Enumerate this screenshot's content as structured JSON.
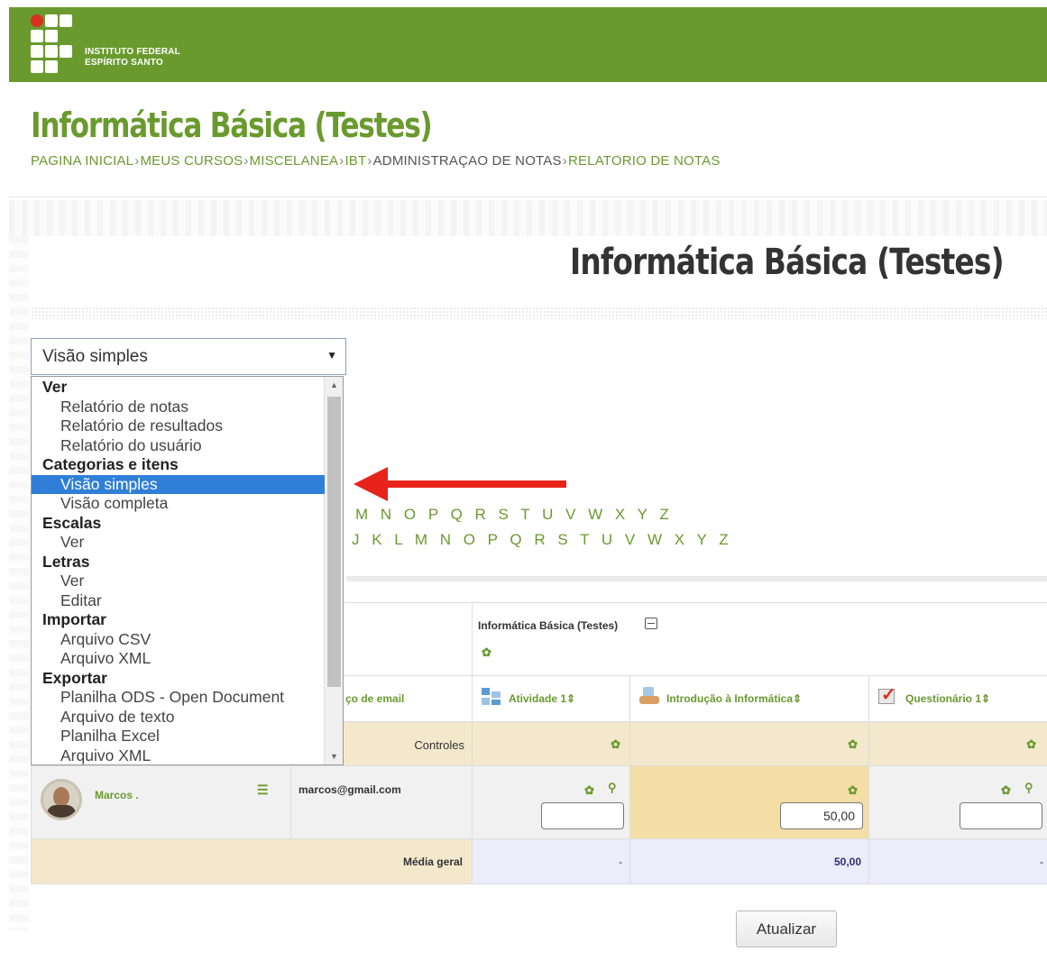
{
  "header": {
    "logo_line1": "INSTITUTO FEDERAL",
    "logo_line2": "ESPÍRITO SANTO",
    "brand_color": "#6a9a2e"
  },
  "course_title": "Informática Básica (Testes)",
  "breadcrumb": [
    "PAGINA INICIAL",
    "MEUS CURSOS",
    "MISCELANEA",
    "IBT",
    "ADMINISTRAÇAO DE NOTAS",
    "RELATORIO DE NOTAS"
  ],
  "page_heading": "Informática Básica (Testes)",
  "view_select": {
    "value": "Visão simples",
    "options": [
      {
        "type": "group",
        "label": "Ver"
      },
      {
        "type": "item",
        "label": "Relatório de notas"
      },
      {
        "type": "item",
        "label": "Relatório de resultados"
      },
      {
        "type": "item",
        "label": "Relatório do usuário"
      },
      {
        "type": "group",
        "label": "Categorias e itens"
      },
      {
        "type": "item",
        "label": "Visão simples",
        "selected": true
      },
      {
        "type": "item",
        "label": "Visão completa"
      },
      {
        "type": "group",
        "label": "Escalas"
      },
      {
        "type": "item",
        "label": "Ver"
      },
      {
        "type": "group",
        "label": "Letras"
      },
      {
        "type": "item",
        "label": "Ver"
      },
      {
        "type": "item",
        "label": "Editar"
      },
      {
        "type": "group",
        "label": "Importar"
      },
      {
        "type": "item",
        "label": "Arquivo CSV"
      },
      {
        "type": "item",
        "label": "Arquivo XML"
      },
      {
        "type": "group",
        "label": "Exportar"
      },
      {
        "type": "item",
        "label": "Planilha ODS - Open Document"
      },
      {
        "type": "item",
        "label": "Arquivo de texto"
      },
      {
        "type": "item",
        "label": "Planilha Excel"
      },
      {
        "type": "item",
        "label": "Arquivo XML"
      }
    ]
  },
  "letters_row1": "M N O P Q R S T U V W X Y Z",
  "letters_row2": "J K L M N O P Q R S T U V W X Y Z",
  "table": {
    "category_name": "Informática Básica (Testes)",
    "email_header": "ço de email",
    "columns": [
      "Atividade 1",
      "Introdução à Informática",
      "Questionário 1"
    ],
    "sort_icon": "⇕",
    "controls_label": "Controles",
    "student": {
      "name": "Marcos .",
      "email": "marcos@gmail.com"
    },
    "grades": [
      "",
      "50,00",
      ""
    ],
    "average_label": "Média geral",
    "averages": [
      "-",
      "50,00",
      "-"
    ]
  },
  "update_button": "Atualizar"
}
